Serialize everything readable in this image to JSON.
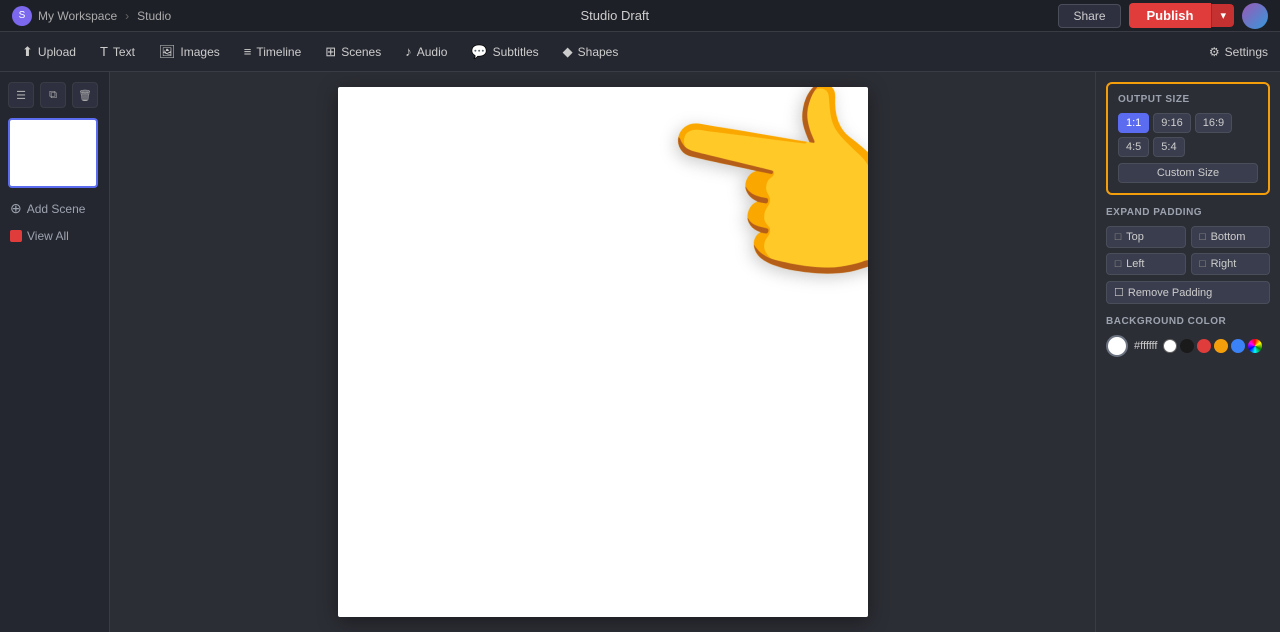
{
  "topbar": {
    "workspace_label": "My Workspace",
    "separator": "›",
    "app_label": "Studio",
    "draft_label": "Studio Draft",
    "share_label": "Share",
    "publish_label": "Publish",
    "settings_label": "Settings"
  },
  "toolbar": {
    "upload_label": "Upload",
    "text_label": "Text",
    "images_label": "Images",
    "timeline_label": "Timeline",
    "scenes_label": "Scenes",
    "audio_label": "Audio",
    "subtitles_label": "Subtitles",
    "shapes_label": "Shapes"
  },
  "sidebar": {
    "add_scene_label": "Add Scene",
    "view_all_label": "View All"
  },
  "right_panel": {
    "output_size_label": "Output Size",
    "size_options": [
      "1:1",
      "9:16",
      "16:9",
      "4:5",
      "5:4"
    ],
    "active_size": "1:1",
    "custom_size_label": "Custom Size",
    "expand_padding_label": "Expand Padding",
    "padding_top_label": "Top",
    "padding_bottom_label": "Bottom",
    "padding_left_label": "Left",
    "padding_right_label": "Right",
    "remove_padding_label": "Remove Padding",
    "bg_color_label": "Background Color",
    "bg_color_value": "#ffffff",
    "color_swatches": [
      "white",
      "black",
      "red",
      "yellow",
      "blue",
      "gradient"
    ]
  }
}
